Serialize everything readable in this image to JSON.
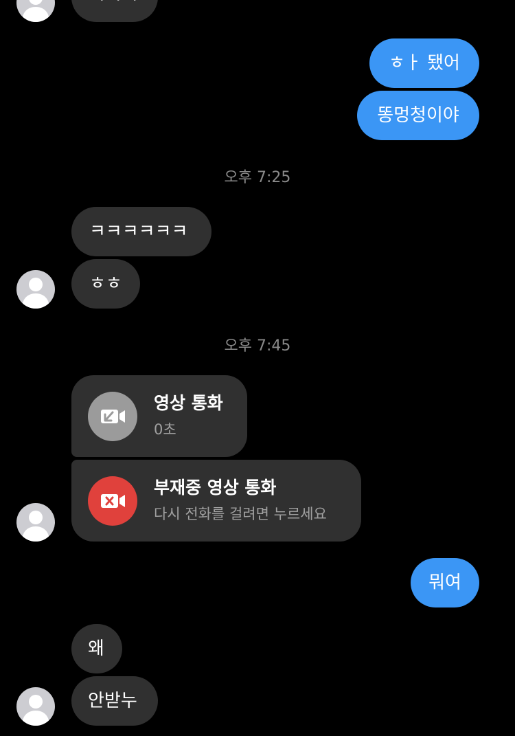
{
  "messages": {
    "top_partial_text": "ㅋㅋㅋ",
    "out_1": "ㅎㅏ 됐어",
    "out_2": "똥멍청이야",
    "time_1": "오후 7:25",
    "in_1": "ㅋㅋㅋㅋㅋㅋ",
    "in_2": "ㅎㅎ",
    "time_2": "오후 7:45",
    "call_1": {
      "title": "영상 통화",
      "subtitle": "0초",
      "icon": "incoming-video-call-icon",
      "icon_bg": "#9b9b9b"
    },
    "call_2": {
      "title": "부재중 영상 통화",
      "subtitle": "다시 전화를 걸려면 누르세요",
      "icon": "missed-video-call-icon",
      "icon_bg": "#e0413c"
    },
    "out_3": "뭐여",
    "in_3": "왜",
    "in_4": "안받누"
  },
  "colors": {
    "background": "#000000",
    "incoming_bubble": "#303030",
    "outgoing_bubble": "#3b96f5",
    "timestamp_text": "#8a8a8a"
  }
}
